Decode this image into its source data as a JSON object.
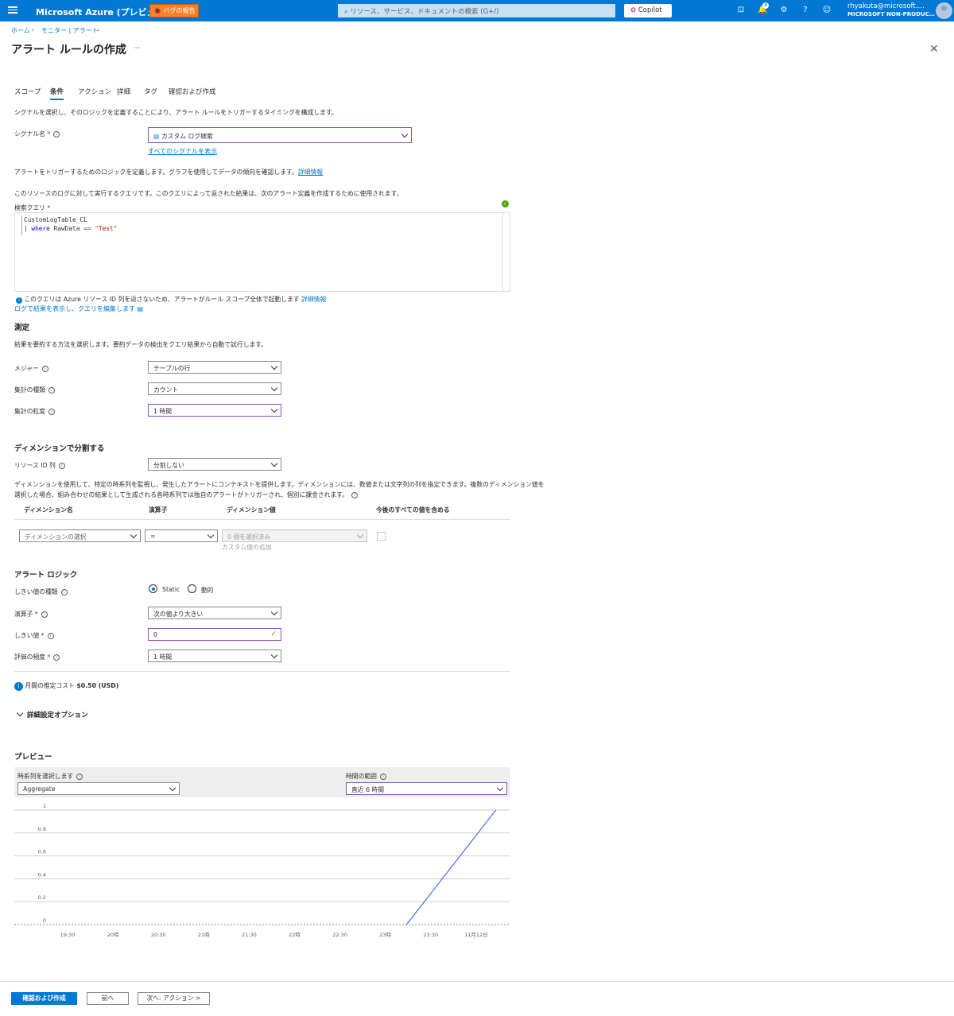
{
  "topbar": {
    "brand": "Microsoft Azure (プレビュー)",
    "bug_report": "バグの報告",
    "search_placeholder": "リソース、サービス、ドキュメントの検索 (G+/)",
    "copilot": "Copilot",
    "notification_count": "8",
    "user_email": "rhyakuta@microsoft.…",
    "user_tenant": "MICROSOFT NON-PRODUC…",
    "icons": [
      "menu-icon",
      "bug-icon",
      "search-icon",
      "copilot-icon",
      "cloud-shell-icon",
      "notification-icon",
      "settings-icon",
      "help-icon",
      "feedback-icon"
    ]
  },
  "breadcrumb": [
    "ホーム",
    "モニター | アラート"
  ],
  "page": {
    "title": "アラート ルールの作成",
    "more": "···",
    "close": "✕"
  },
  "tabs": [
    "スコープ",
    "条件",
    "アクション",
    "詳細",
    "タグ",
    "確認および作成"
  ],
  "active_tab": "条件",
  "condition": {
    "intro": "シグナルを選択し、そのロジックを定義することにより、アラート ルールをトリガーするタイミングを構成します。",
    "signal_label": "シグナル名",
    "signal_value": "カスタム ログ検索",
    "signal_link": "すべてのシグナルを表示",
    "logic_text": "アラートをトリガーするためのロジックを定義します。グラフを使用してデータの傾向を確認します。",
    "logic_link": "詳細情報",
    "query_desc": "このリソースのログに対して実行するクエリです。このクエリによって返された結果は、次のアラート定義を作成するために使用されます。",
    "query_label": "検索クエリ",
    "query_line1": "CustomLogTable_CL",
    "query_line2_pipe": "| ",
    "query_line2_kw": "where",
    "query_line2_mid": " RawData == ",
    "query_line2_str": "\"Test\"",
    "query_note": "このクエリは Azure リソース ID 列を返さないため、アラートがルール スコープ全体で起動します",
    "query_note_link": "詳細情報",
    "view_logs_link": "ログで結果を表示し、クエリを編集します"
  },
  "measurement": {
    "title": "測定",
    "desc": "結果を要約する方法を選択します。要約データの検出をクエリ結果から自動で試行します。",
    "measure_label": "メジャー",
    "measure_value": "テーブルの行",
    "agg_type_label": "集計の種類",
    "agg_type_value": "カウント",
    "agg_gran_label": "集計の粒度",
    "agg_gran_value": "1 時間"
  },
  "dimensions": {
    "title": "ディメンションで分割する",
    "resource_id_label": "リソース ID 列",
    "resource_id_value": "分割しない",
    "desc1": "ディメンションを使用して、特定の時系列を監視し、発生したアラートにコンテキストを提供します。ディメンションには、数値または文字列の列を指定できます。複数のディメンション値を",
    "desc2": "選択した場合、組み合わせの結果として生成される各時系列では独自のアラートがトリガーされ、個別に課金されます。",
    "col_name": "ディメンション名",
    "col_op": "演算子",
    "col_values": "ディメンション値",
    "col_include": "今後のすべての値を含める",
    "row_name": "ディメンションの選択",
    "row_op": "=",
    "row_values": "0 個を選択済み",
    "add_custom": "カスタム値の追加"
  },
  "alert_logic": {
    "title": "アラート ロジック",
    "threshold_type_label": "しきい値の種類",
    "static": "Static",
    "dynamic": "動的",
    "operator_label": "演算子",
    "operator_value": "次の値より大きい",
    "threshold_label": "しきい値",
    "threshold_value": "0",
    "frequency_label": "評価の頻度",
    "frequency_value": "1 時間",
    "cost_label": "月間の推定コスト",
    "cost_value": "$0.50 (USD)",
    "advanced": "詳細設定オプション"
  },
  "preview": {
    "title": "プレビュー",
    "series_label": "時系列を選択します",
    "series_value": "Aggregate",
    "range_label": "時間の範囲",
    "range_value": "直近 6 時間"
  },
  "chart_data": {
    "type": "line",
    "x": [
      "19:30",
      "20時",
      "20:30",
      "21時",
      "21:30",
      "22時",
      "22:30",
      "23時",
      "23:30",
      "11月12日"
    ],
    "y_ticks": [
      "0",
      "0.2",
      "0.4",
      "0.6",
      "0.8",
      "1"
    ],
    "ylim": [
      0,
      1
    ],
    "series": [
      {
        "points": [
          [
            "23:14",
            0
          ],
          [
            "00:13",
            1
          ]
        ]
      }
    ],
    "color": "#4f6bed"
  },
  "footer": {
    "review": "確認および作成",
    "prev": "前へ",
    "next": "次へ: アクション >"
  }
}
